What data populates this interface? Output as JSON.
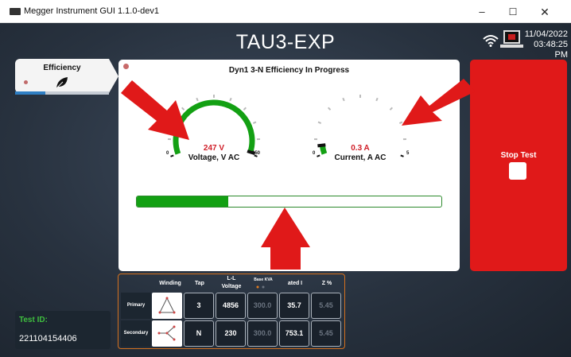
{
  "window": {
    "title": "Megger Instrument GUI 1.1.0-dev1",
    "minimize": "–",
    "maximize": "☐",
    "close": "✕"
  },
  "app": {
    "title": "TAU3-EXP",
    "date": "11/04/2022",
    "time": "03:48:25 PM"
  },
  "sidebar": {
    "tab_label": "Efficiency",
    "tab_icon": "leaf-icon",
    "tab_progress": 0.32
  },
  "panel": {
    "heading": "Dyn1 3-N Efficiency  In Progress",
    "voltage_gauge": {
      "value_text": "247 V",
      "unit_label": "Voltage, V AC",
      "min_label": "0",
      "max_label": "250",
      "min": 0,
      "max": 250,
      "value": 247,
      "active_color": "#13a013"
    },
    "current_gauge": {
      "value_text": "0.3 A",
      "unit_label": "Current, A AC",
      "min_label": "0",
      "max_label": "5",
      "min": 0,
      "max": 5,
      "value": 0.3,
      "active_color": "#13a013"
    },
    "progress": 0.3
  },
  "stop": {
    "label": "Stop Test",
    "color": "#e01919"
  },
  "test": {
    "label": "Test ID:",
    "id": "221104154406"
  },
  "table": {
    "headers": {
      "winding": "Winding",
      "tap": "Tap",
      "ll_voltage": "L-L\nVoltage",
      "base_kva": "Base KVA",
      "rated_i": "ated I",
      "z_pct": "Z %"
    },
    "rows": [
      {
        "label": "Primary",
        "tap": "3",
        "ll_voltage": "4856",
        "base_kva": "300.0",
        "rated_i": "35.7",
        "z_pct": "5.45"
      },
      {
        "label": "Secondary",
        "tap": "N",
        "ll_voltage": "230",
        "base_kva": "300.0",
        "rated_i": "753.1",
        "z_pct": "5.45"
      }
    ]
  },
  "colors": {
    "accent_green": "#13a013",
    "value_red": "#d0202a",
    "arrow_red": "#e01919",
    "table_border": "#d4711f",
    "test_id_green": "#3fbf3f"
  }
}
